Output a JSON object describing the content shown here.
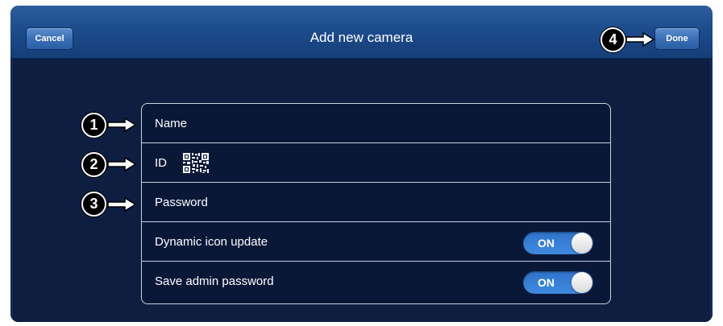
{
  "header": {
    "title": "Add new camera",
    "cancel_label": "Cancel",
    "done_label": "Done"
  },
  "form": {
    "name_placeholder": "Name",
    "id_placeholder": "ID",
    "password_placeholder": "Password",
    "dynamic_icon_label": "Dynamic icon update",
    "dynamic_icon_toggle": "ON",
    "save_admin_label": "Save admin password",
    "save_admin_toggle": "ON"
  },
  "callouts": [
    "1",
    "2",
    "3",
    "4"
  ],
  "icons": {
    "qr": "qr-code-icon",
    "arrow": "arrow-right-icon"
  },
  "colors": {
    "navbar": "#1d4c8d",
    "background": "#0d1e41",
    "toggle_on": "#3f8be0"
  }
}
